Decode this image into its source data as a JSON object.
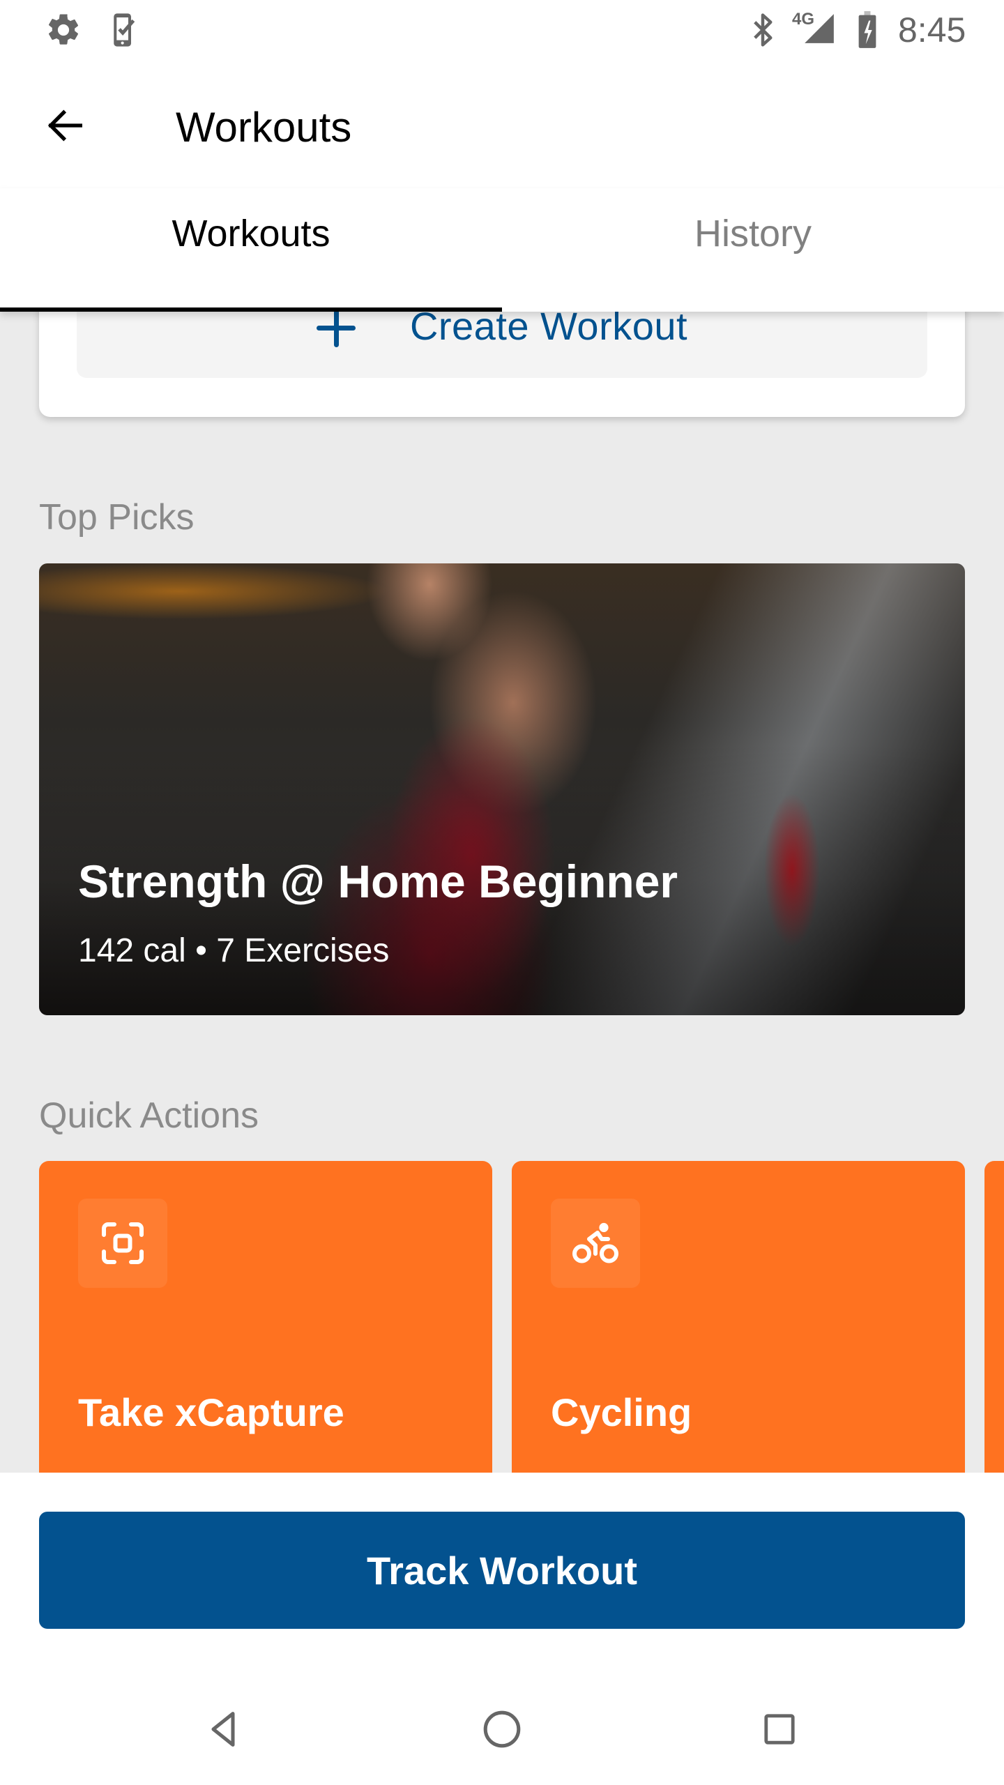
{
  "status_bar": {
    "left_icons": [
      "gear-icon",
      "phone-check-icon"
    ],
    "right_icons": [
      "bluetooth-icon",
      "signal-4g-icon",
      "battery-charging-icon"
    ],
    "network_label": "4G",
    "time": "8:45"
  },
  "app_bar": {
    "back_icon": "arrow-left-icon",
    "title": "Workouts"
  },
  "tabs": [
    {
      "label": "Workouts",
      "active": true
    },
    {
      "label": "History",
      "active": false
    }
  ],
  "create_workout": {
    "icon": "plus-icon",
    "label": "Create Workout"
  },
  "top_picks": {
    "section_title": "Top Picks",
    "featured": {
      "title": "Strength @ Home Beginner",
      "subtitle": "142 cal • 7 Exercises",
      "calories": "142 cal",
      "exercises": "7 Exercises"
    }
  },
  "quick_actions": {
    "section_title": "Quick Actions",
    "items": [
      {
        "label": "Take xCapture",
        "icon": "scan-frame-icon"
      },
      {
        "label": "Cycling",
        "icon": "cyclist-icon"
      },
      {
        "label": "",
        "icon": ""
      }
    ]
  },
  "primary_action": {
    "label": "Track Workout"
  },
  "nav_bar": {
    "buttons": [
      "back-triangle-icon",
      "home-circle-icon",
      "recents-square-icon"
    ]
  },
  "colors": {
    "brand_blue": "#03528f",
    "accent_orange": "#ff7220",
    "background": "#ebebeb",
    "section_title_gray": "#8a8a8a"
  }
}
